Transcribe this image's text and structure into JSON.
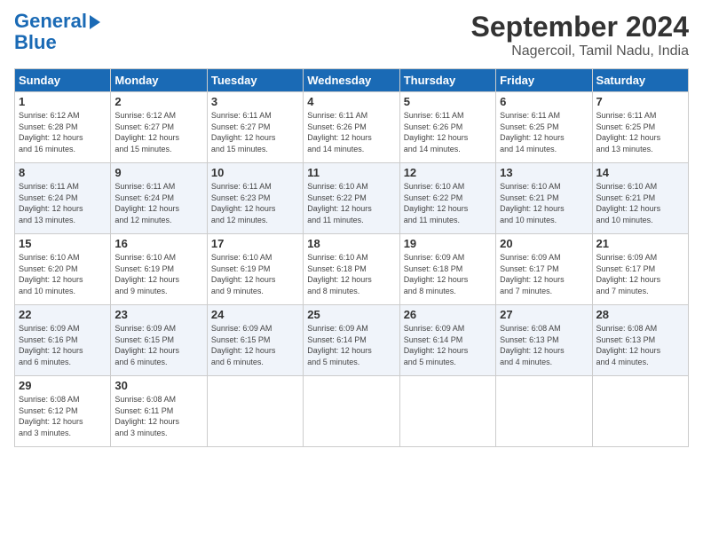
{
  "header": {
    "logo_line1": "General",
    "logo_line2": "Blue",
    "title": "September 2024",
    "subtitle": "Nagercoil, Tamil Nadu, India"
  },
  "days_of_week": [
    "Sunday",
    "Monday",
    "Tuesday",
    "Wednesday",
    "Thursday",
    "Friday",
    "Saturday"
  ],
  "weeks": [
    [
      {
        "day": "1",
        "sunrise": "6:12 AM",
        "sunset": "6:28 PM",
        "daylight": "12 hours and 16 minutes."
      },
      {
        "day": "2",
        "sunrise": "6:12 AM",
        "sunset": "6:27 PM",
        "daylight": "12 hours and 15 minutes."
      },
      {
        "day": "3",
        "sunrise": "6:11 AM",
        "sunset": "6:27 PM",
        "daylight": "12 hours and 15 minutes."
      },
      {
        "day": "4",
        "sunrise": "6:11 AM",
        "sunset": "6:26 PM",
        "daylight": "12 hours and 14 minutes."
      },
      {
        "day": "5",
        "sunrise": "6:11 AM",
        "sunset": "6:26 PM",
        "daylight": "12 hours and 14 minutes."
      },
      {
        "day": "6",
        "sunrise": "6:11 AM",
        "sunset": "6:25 PM",
        "daylight": "12 hours and 14 minutes."
      },
      {
        "day": "7",
        "sunrise": "6:11 AM",
        "sunset": "6:25 PM",
        "daylight": "12 hours and 13 minutes."
      }
    ],
    [
      {
        "day": "8",
        "sunrise": "6:11 AM",
        "sunset": "6:24 PM",
        "daylight": "12 hours and 13 minutes."
      },
      {
        "day": "9",
        "sunrise": "6:11 AM",
        "sunset": "6:24 PM",
        "daylight": "12 hours and 12 minutes."
      },
      {
        "day": "10",
        "sunrise": "6:11 AM",
        "sunset": "6:23 PM",
        "daylight": "12 hours and 12 minutes."
      },
      {
        "day": "11",
        "sunrise": "6:10 AM",
        "sunset": "6:22 PM",
        "daylight": "12 hours and 11 minutes."
      },
      {
        "day": "12",
        "sunrise": "6:10 AM",
        "sunset": "6:22 PM",
        "daylight": "12 hours and 11 minutes."
      },
      {
        "day": "13",
        "sunrise": "6:10 AM",
        "sunset": "6:21 PM",
        "daylight": "12 hours and 10 minutes."
      },
      {
        "day": "14",
        "sunrise": "6:10 AM",
        "sunset": "6:21 PM",
        "daylight": "12 hours and 10 minutes."
      }
    ],
    [
      {
        "day": "15",
        "sunrise": "6:10 AM",
        "sunset": "6:20 PM",
        "daylight": "12 hours and 10 minutes."
      },
      {
        "day": "16",
        "sunrise": "6:10 AM",
        "sunset": "6:19 PM",
        "daylight": "12 hours and 9 minutes."
      },
      {
        "day": "17",
        "sunrise": "6:10 AM",
        "sunset": "6:19 PM",
        "daylight": "12 hours and 9 minutes."
      },
      {
        "day": "18",
        "sunrise": "6:10 AM",
        "sunset": "6:18 PM",
        "daylight": "12 hours and 8 minutes."
      },
      {
        "day": "19",
        "sunrise": "6:09 AM",
        "sunset": "6:18 PM",
        "daylight": "12 hours and 8 minutes."
      },
      {
        "day": "20",
        "sunrise": "6:09 AM",
        "sunset": "6:17 PM",
        "daylight": "12 hours and 7 minutes."
      },
      {
        "day": "21",
        "sunrise": "6:09 AM",
        "sunset": "6:17 PM",
        "daylight": "12 hours and 7 minutes."
      }
    ],
    [
      {
        "day": "22",
        "sunrise": "6:09 AM",
        "sunset": "6:16 PM",
        "daylight": "12 hours and 6 minutes."
      },
      {
        "day": "23",
        "sunrise": "6:09 AM",
        "sunset": "6:15 PM",
        "daylight": "12 hours and 6 minutes."
      },
      {
        "day": "24",
        "sunrise": "6:09 AM",
        "sunset": "6:15 PM",
        "daylight": "12 hours and 6 minutes."
      },
      {
        "day": "25",
        "sunrise": "6:09 AM",
        "sunset": "6:14 PM",
        "daylight": "12 hours and 5 minutes."
      },
      {
        "day": "26",
        "sunrise": "6:09 AM",
        "sunset": "6:14 PM",
        "daylight": "12 hours and 5 minutes."
      },
      {
        "day": "27",
        "sunrise": "6:08 AM",
        "sunset": "6:13 PM",
        "daylight": "12 hours and 4 minutes."
      },
      {
        "day": "28",
        "sunrise": "6:08 AM",
        "sunset": "6:13 PM",
        "daylight": "12 hours and 4 minutes."
      }
    ],
    [
      {
        "day": "29",
        "sunrise": "6:08 AM",
        "sunset": "6:12 PM",
        "daylight": "12 hours and 3 minutes."
      },
      {
        "day": "30",
        "sunrise": "6:08 AM",
        "sunset": "6:11 PM",
        "daylight": "12 hours and 3 minutes."
      },
      null,
      null,
      null,
      null,
      null
    ]
  ]
}
